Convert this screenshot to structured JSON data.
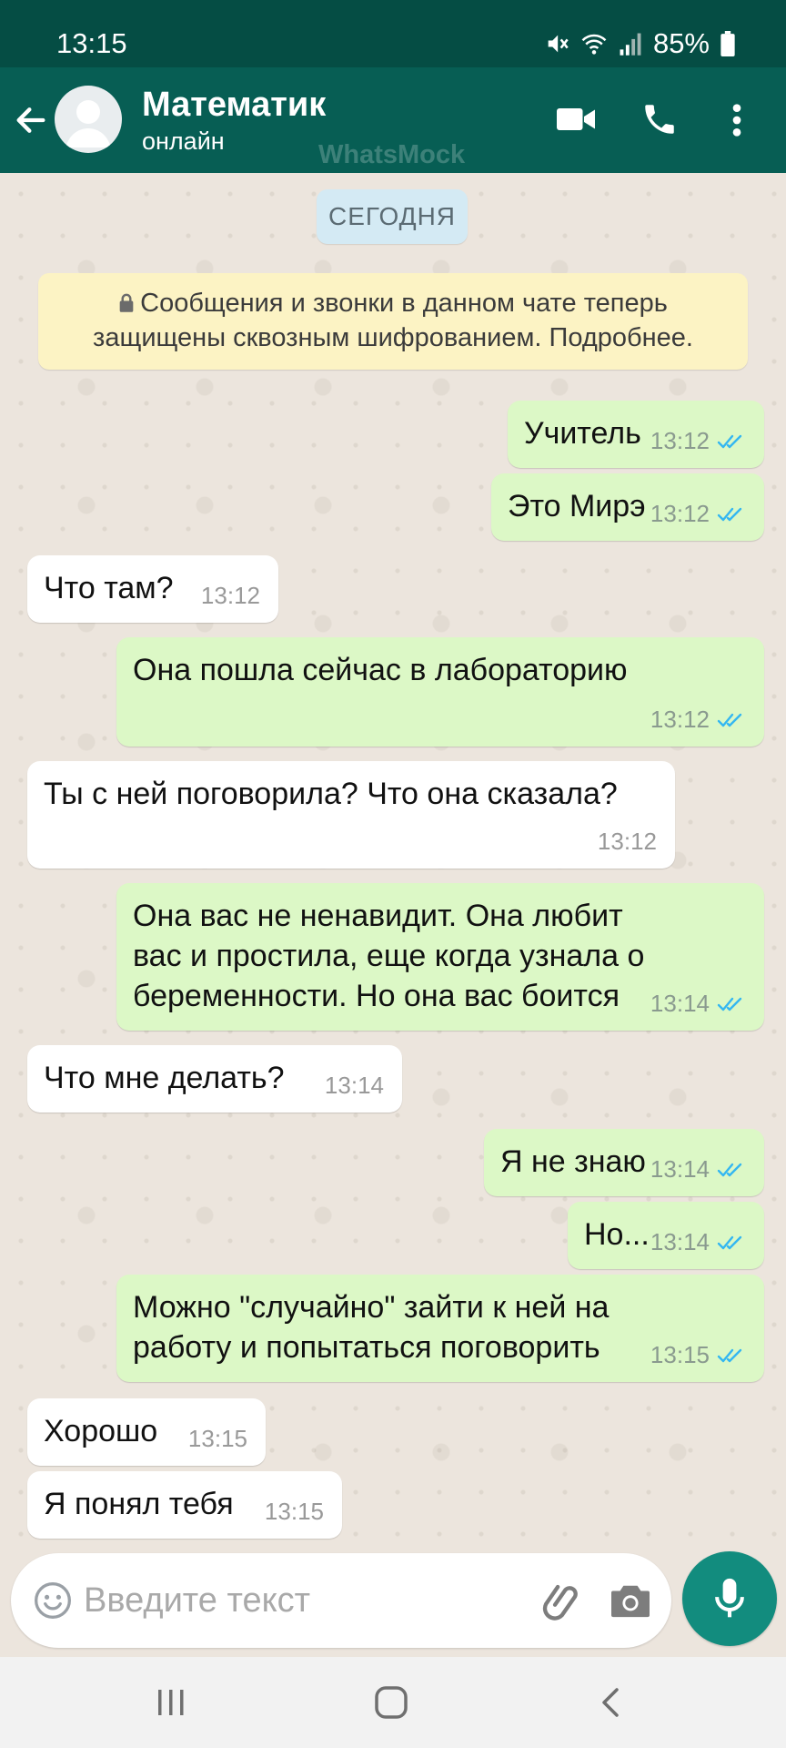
{
  "status_bar": {
    "time": "13:15",
    "battery": "85%"
  },
  "header": {
    "contact_name": "Математик",
    "contact_status": "онлайн",
    "watermark": "WhatsMock"
  },
  "chat": {
    "date_label": "СЕГОДНЯ",
    "encryption_notice_line1": "Сообщения и звонки в данном чате теперь",
    "encryption_notice_line2": "защищены сквозным шифрованием. Подробнее.",
    "messages": [
      {
        "direction": "out",
        "text": "Учитель",
        "time": "13:12",
        "read": true
      },
      {
        "direction": "out",
        "text": "Это Мирэ",
        "time": "13:12",
        "read": true
      },
      {
        "direction": "in",
        "text": "Что там?",
        "time": "13:12"
      },
      {
        "direction": "out",
        "text": "Она пошла сейчас в лабораторию",
        "time": "13:12",
        "read": true
      },
      {
        "direction": "in",
        "text": "Ты с ней поговорила? Что она сказала?",
        "time": "13:12"
      },
      {
        "direction": "out",
        "text": "Она вас не ненавидит. Она любит\nвас и простила, еще когда узнала о\nбеременности. Но она вас боится",
        "time": "13:14",
        "read": true
      },
      {
        "direction": "in",
        "text": "Что мне делать?",
        "time": "13:14"
      },
      {
        "direction": "out",
        "text": "Я не знаю",
        "time": "13:14",
        "read": true
      },
      {
        "direction": "out",
        "text": "Но...",
        "time": "13:14",
        "read": true
      },
      {
        "direction": "out",
        "text": "Можно \"случайно\" зайти к ней на\nработу и попытаться поговорить",
        "time": "13:15",
        "read": true
      },
      {
        "direction": "in",
        "text": "Хорошо",
        "time": "13:15"
      },
      {
        "direction": "in",
        "text": "Я понял тебя",
        "time": "13:15"
      }
    ]
  },
  "input": {
    "placeholder": "Введите текст"
  },
  "colors": {
    "header": "#075e54",
    "status_bar": "#054d44",
    "outgoing_bubble": "#dcf8c6",
    "incoming_bubble": "#ffffff",
    "read_ticks": "#34b7f1",
    "mic_button": "#128c7e"
  },
  "icons": [
    "back-arrow-icon",
    "avatar-placeholder-icon",
    "video-call-icon",
    "phone-icon",
    "more-vert-icon",
    "lock-icon",
    "emoji-icon",
    "attach-icon",
    "camera-icon",
    "mic-icon",
    "mute-icon",
    "wifi-icon",
    "signal-icon",
    "battery-icon"
  ]
}
